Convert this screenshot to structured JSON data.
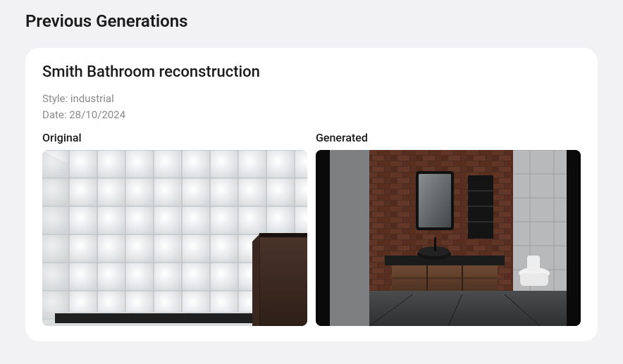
{
  "section": {
    "title": "Previous Generations"
  },
  "generation": {
    "name": "Smith Bathroom reconstruction",
    "style_label": "Style: industrial",
    "date_label": "Date: 28/10/2024",
    "original_label": "Original",
    "generated_label": "Generated"
  }
}
